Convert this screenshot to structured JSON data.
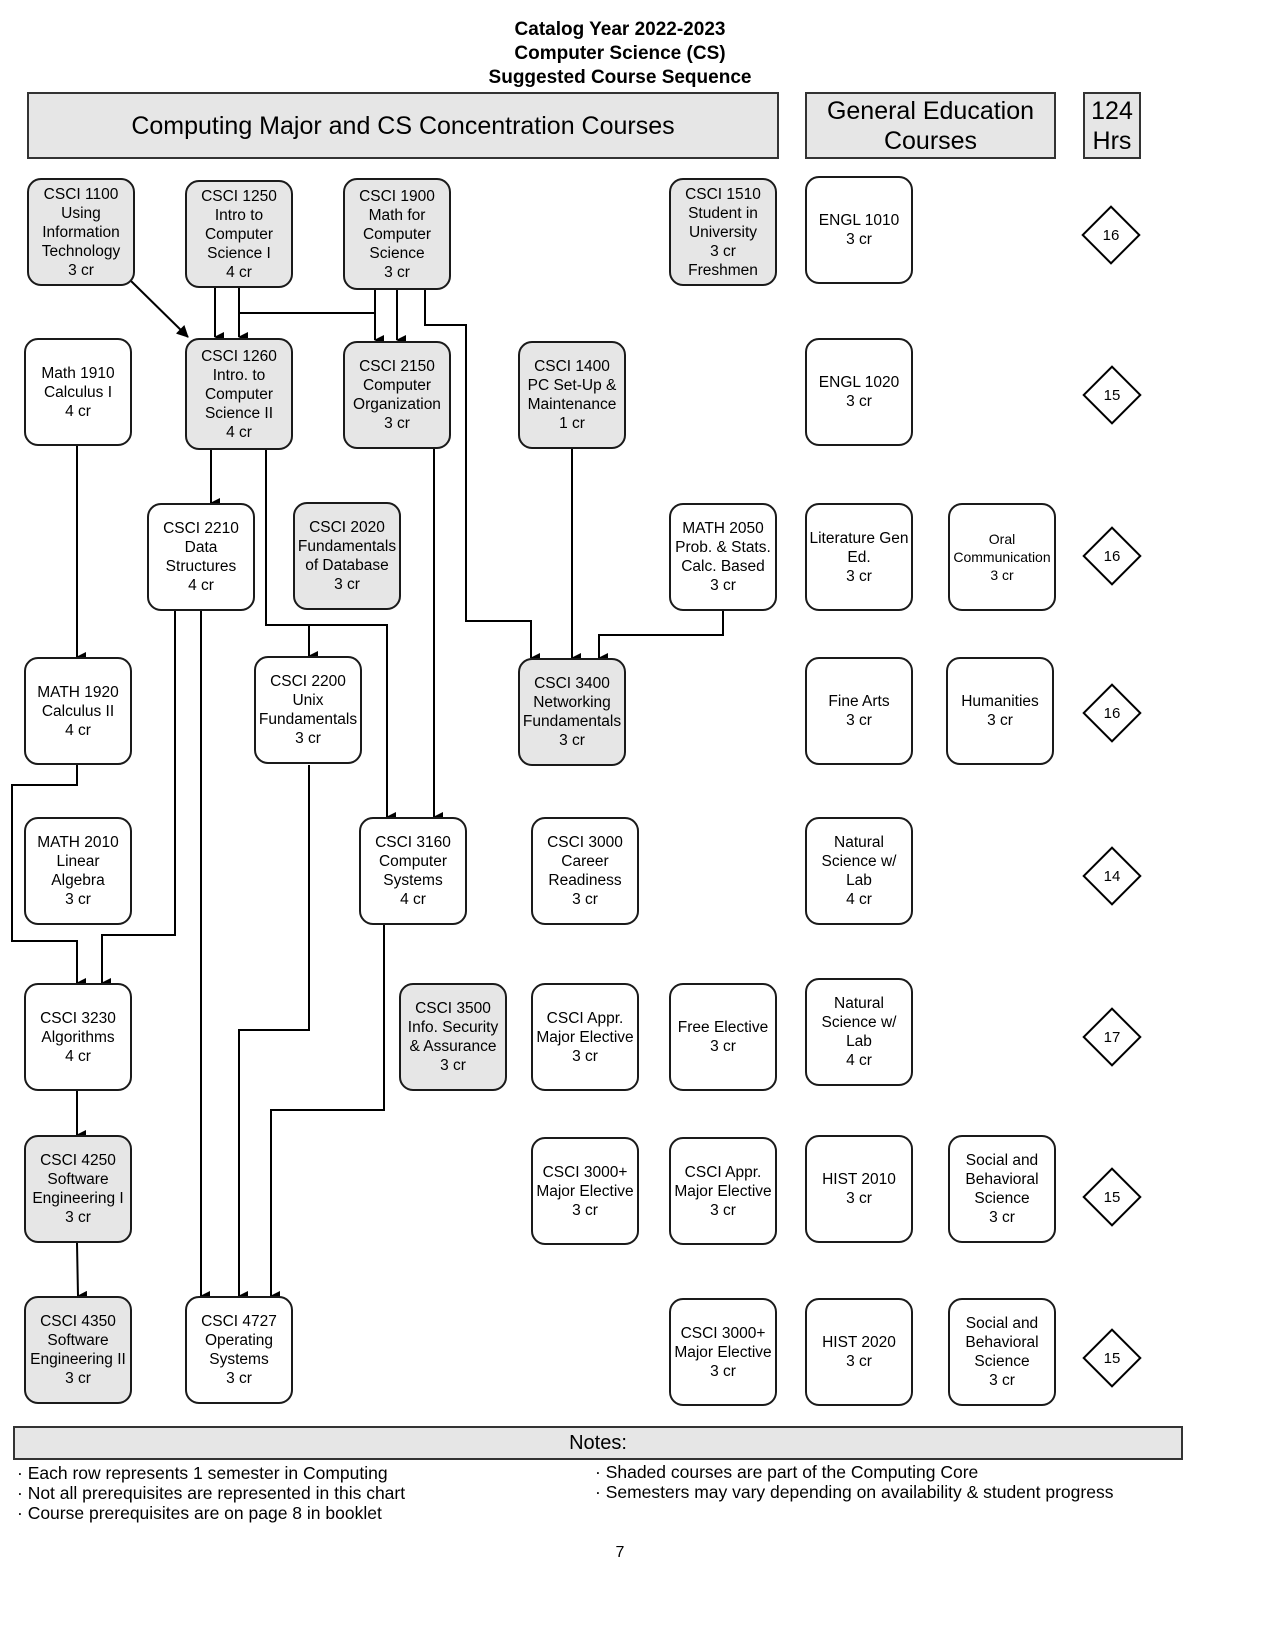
{
  "title": {
    "line1": "Catalog Year 2022-2023",
    "line2": "Computer Science (CS)",
    "line3": "Suggested Course Sequence"
  },
  "headers": {
    "major": "Computing Major and CS Concentration Courses",
    "gen_ed_line1": "General Education",
    "gen_ed_line2": "Courses",
    "hours_line1": "124",
    "hours_line2": "Hrs"
  },
  "courses": {
    "csci1100": {
      "lines": [
        "CSCI 1100",
        "Using",
        "Information",
        "Technology",
        "3 cr"
      ],
      "core": true
    },
    "csci1250": {
      "lines": [
        "CSCI 1250",
        "Intro to",
        "Computer",
        "Science I",
        "4 cr"
      ],
      "core": true
    },
    "csci1900": {
      "lines": [
        "CSCI 1900",
        "Math for",
        "Computer",
        "Science",
        "3 cr"
      ],
      "core": true
    },
    "csci1510": {
      "lines": [
        "CSCI 1510",
        "Student in",
        "University",
        "3 cr",
        "Freshmen"
      ],
      "core": true
    },
    "engl1010": {
      "lines": [
        "ENGL 1010",
        "3 cr"
      ],
      "core": false
    },
    "math1910": {
      "lines": [
        "Math 1910",
        "Calculus I",
        "4 cr"
      ],
      "core": false
    },
    "csci1260": {
      "lines": [
        "CSCI 1260",
        "Intro. to",
        "Computer",
        "Science II",
        "4 cr"
      ],
      "core": true
    },
    "csci2150": {
      "lines": [
        "CSCI 2150",
        "Computer",
        "Organization",
        "3 cr"
      ],
      "core": true
    },
    "csci1400": {
      "lines": [
        "CSCI 1400",
        "PC Set-Up &",
        "Maintenance",
        "1 cr"
      ],
      "core": true
    },
    "engl1020": {
      "lines": [
        "ENGL 1020",
        "3 cr"
      ],
      "core": false
    },
    "csci2210": {
      "lines": [
        "CSCI 2210",
        "Data",
        "Structures",
        "4 cr"
      ],
      "core": false
    },
    "csci2020": {
      "lines": [
        "CSCI 2020",
        "Fundamentals",
        "of Database",
        "3 cr"
      ],
      "core": true
    },
    "math2050": {
      "lines": [
        "MATH 2050",
        "Prob. & Stats.",
        "Calc. Based",
        "3 cr"
      ],
      "core": false
    },
    "literature": {
      "lines": [
        "Literature Gen",
        "Ed.",
        "3 cr"
      ],
      "core": false
    },
    "oral": {
      "lines": [
        "Oral",
        "Communication",
        "3 cr"
      ],
      "core": false
    },
    "math1920": {
      "lines": [
        "MATH 1920",
        "Calculus II",
        "4 cr"
      ],
      "core": false
    },
    "csci2200": {
      "lines": [
        "CSCI 2200",
        "Unix",
        "Fundamentals",
        "3 cr"
      ],
      "core": false
    },
    "csci3400": {
      "lines": [
        "CSCI 3400",
        "Networking",
        "Fundamentals",
        "3 cr"
      ],
      "core": true
    },
    "finearts": {
      "lines": [
        "Fine Arts",
        "3 cr"
      ],
      "core": false
    },
    "humanities": {
      "lines": [
        "Humanities",
        "3 cr"
      ],
      "core": false
    },
    "math2010": {
      "lines": [
        "MATH 2010",
        "Linear",
        "Algebra",
        "3 cr"
      ],
      "core": false
    },
    "csci3160": {
      "lines": [
        "CSCI 3160",
        "Computer",
        "Systems",
        "4 cr"
      ],
      "core": false
    },
    "csci3000": {
      "lines": [
        "CSCI 3000",
        "Career",
        "Readiness",
        "3 cr"
      ],
      "core": false
    },
    "natsci1": {
      "lines": [
        "Natural",
        "Science w/",
        "Lab",
        "4 cr"
      ],
      "core": false
    },
    "csci3230": {
      "lines": [
        "CSCI 3230",
        "Algorithms",
        "4 cr"
      ],
      "core": false
    },
    "csci3500": {
      "lines": [
        "CSCI 3500",
        "Info. Security",
        "& Assurance",
        "3 cr"
      ],
      "core": true
    },
    "appr1": {
      "lines": [
        "CSCI Appr.",
        "Major Elective",
        "3 cr"
      ],
      "core": false
    },
    "freeelective": {
      "lines": [
        "Free Elective",
        "3 cr"
      ],
      "core": false
    },
    "natsci2": {
      "lines": [
        "Natural",
        "Science w/",
        "Lab",
        "4 cr"
      ],
      "core": false
    },
    "csci4250": {
      "lines": [
        "CSCI 4250",
        "Software",
        "Engineering I",
        "3 cr"
      ],
      "core": true
    },
    "elective3000a": {
      "lines": [
        "CSCI 3000+",
        "Major Elective",
        "3 cr"
      ],
      "core": false
    },
    "appr2": {
      "lines": [
        "CSCI Appr.",
        "Major Elective",
        "3 cr"
      ],
      "core": false
    },
    "hist2010": {
      "lines": [
        "HIST 2010",
        "3 cr"
      ],
      "core": false
    },
    "socsci1": {
      "lines": [
        "Social and",
        "Behavioral",
        "Science",
        "3 cr"
      ],
      "core": false
    },
    "csci4350": {
      "lines": [
        "CSCI 4350",
        "Software",
        "Engineering II",
        "3 cr"
      ],
      "core": true
    },
    "csci4727": {
      "lines": [
        "CSCI 4727",
        "Operating",
        "Systems",
        "3 cr"
      ],
      "core": false
    },
    "elective3000b": {
      "lines": [
        "CSCI 3000+",
        "Major Elective",
        "3 cr"
      ],
      "core": false
    },
    "hist2020": {
      "lines": [
        "HIST 2020",
        "3 cr"
      ],
      "core": false
    },
    "socsci2": {
      "lines": [
        "Social and",
        "Behavioral",
        "Science",
        "3 cr"
      ],
      "core": false
    }
  },
  "semester_hours": [
    "16",
    "15",
    "16",
    "16",
    "14",
    "17",
    "15",
    "15"
  ],
  "prerequisite_links": [
    [
      "csci1100",
      "csci1260"
    ],
    [
      "csci1250",
      "csci1260"
    ],
    [
      "csci1900",
      "csci1260"
    ],
    [
      "csci1250",
      "csci2150"
    ],
    [
      "csci1900",
      "csci2150"
    ],
    [
      "csci1900",
      "csci3400"
    ],
    [
      "csci1400",
      "csci3400"
    ],
    [
      "math2050",
      "csci3400"
    ],
    [
      "math1910",
      "math1920"
    ],
    [
      "csci1260",
      "csci2210"
    ],
    [
      "csci1260",
      "csci2200"
    ],
    [
      "csci1260",
      "csci3160"
    ],
    [
      "csci2150",
      "csci3160"
    ],
    [
      "math1920",
      "csci3230"
    ],
    [
      "csci2210",
      "csci3230"
    ],
    [
      "csci2210",
      "csci4727"
    ],
    [
      "csci2200",
      "csci4727"
    ],
    [
      "csci3160",
      "csci4727"
    ],
    [
      "csci3230",
      "csci4250"
    ],
    [
      "csci4250",
      "csci4350"
    ]
  ],
  "notes": {
    "header": "Notes:",
    "left": [
      "· Each row represents 1 semester in Computing",
      "· Not all prerequisites are represented in this chart",
      "· Course prerequisites are on page 8 in booklet"
    ],
    "right": [
      "· Shaded courses are part of the Computing Core",
      "· Semesters may vary depending on availability & student progress"
    ]
  },
  "page_number": "7",
  "colors": {
    "core_fill": "#e6e6e6",
    "border": "#1a1a1a"
  }
}
